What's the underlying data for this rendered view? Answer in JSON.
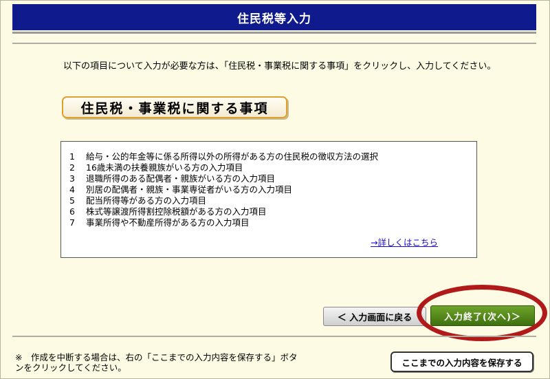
{
  "header": {
    "title": "住民税等入力"
  },
  "intro": {
    "text": "以下の項目について入力が必要な方は、「住民税・事業税に関する事項」をクリックし、入力してください。"
  },
  "section_button": {
    "label": "住民税・事業税に関する事項"
  },
  "info_box": {
    "items": [
      {
        "num": "1",
        "text": "給与・公的年金等に係る所得以外の所得がある方の住民税の徴収方法の選択"
      },
      {
        "num": "2",
        "text": "16歳未満の扶養親族がいる方の入力項目"
      },
      {
        "num": "3",
        "text": "退職所得のある配偶者・親族がいる方の入力項目"
      },
      {
        "num": "4",
        "text": "別居の配偶者・親族・事業専従者がいる方の入力項目"
      },
      {
        "num": "5",
        "text": "配当所得等がある方の入力項目"
      },
      {
        "num": "6",
        "text": "株式等譲渡所得割控除税額がある方の入力項目"
      },
      {
        "num": "7",
        "text": "事業所得や不動産所得がある方の入力項目"
      }
    ],
    "detail_link": "→詳しくはこちら"
  },
  "navigation": {
    "back_label": "＜ 入力画面に戻る",
    "next_label": "入力終了(次へ)＞"
  },
  "footer": {
    "note": "※　作成を中断する場合は、右の「ここまでの入力内容を保存する」ボタンをクリックしてください。",
    "save_label": "ここまでの入力内容を保存する"
  },
  "colors": {
    "title_bar": "#0f1a8c",
    "next_button": "#4f8a18",
    "highlight": "#b01a1a",
    "background": "#fdfbe3"
  }
}
